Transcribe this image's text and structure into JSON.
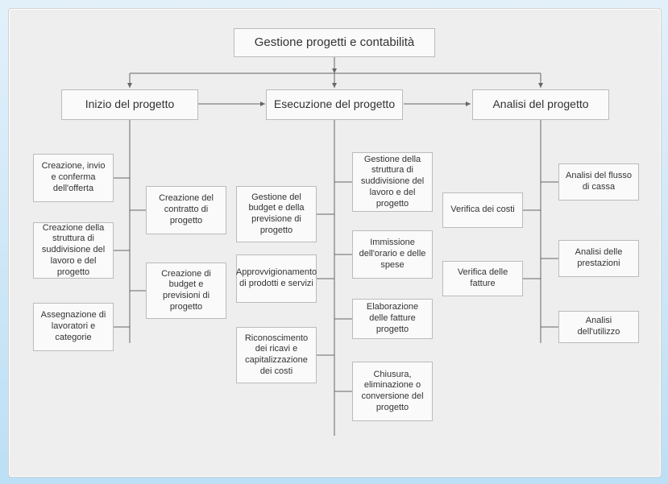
{
  "root": "Gestione progetti e contabilità",
  "phases": [
    {
      "title": "Inizio del progetto",
      "left": [
        "Creazione, invio e conferma dell'offerta",
        "Creazione della struttura di suddivisione del lavoro e del progetto",
        "Assegnazione di lavoratori e categorie"
      ],
      "right": [
        "Creazione del contratto di progetto",
        "Creazione di budget e previsioni di progetto"
      ]
    },
    {
      "title": "Esecuzione del progetto",
      "left": [
        "Gestione del budget e della previsione di progetto",
        "Approvvigionamento di prodotti e servizi",
        "Riconoscimento dei ricavi e capitalizzazione dei costi"
      ],
      "right": [
        "Gestione della struttura di suddivisione del lavoro e del progetto",
        "Immissione dell'orario e delle spese",
        "Elaborazione delle fatture progetto",
        "Chiusura, eliminazione o conversione del progetto"
      ]
    },
    {
      "title": "Analisi del progetto",
      "left": [
        "Verifica dei costi",
        "Verifica delle fatture"
      ],
      "right": [
        "Analisi del flusso di cassa",
        "Analisi delle prestazioni",
        "Analisi dell'utilizzo"
      ]
    }
  ]
}
